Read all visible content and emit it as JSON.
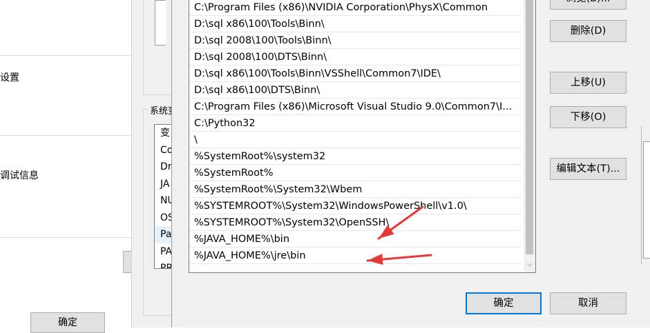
{
  "background_window": {
    "settings_fragment": "设置",
    "debug_fragment": "调试信息",
    "ok_button": "确定"
  },
  "system_properties": {
    "group_label": "系统变量(S)",
    "list_rows": [
      "变",
      "Co",
      "Dr",
      "JA",
      "NU",
      "OS",
      "Pa",
      "PA",
      "PR"
    ]
  },
  "edit_env_dialog": {
    "path_entries": [
      "C:\\Program Files (x86)\\NVIDIA Corporation\\PhysX\\Common",
      "D:\\sql x86\\100\\Tools\\Binn\\",
      "D:\\sql 2008\\100\\Tools\\Binn\\",
      "D:\\sql 2008\\100\\DTS\\Binn\\",
      "D:\\sql x86\\100\\Tools\\Binn\\VSShell\\Common7\\IDE\\",
      "D:\\sql x86\\100\\DTS\\Binn\\",
      "C:\\Program Files (x86)\\Microsoft Visual Studio 9.0\\Common7\\I...",
      "C:\\Python32",
      "\\",
      "%SystemRoot%\\system32",
      "%SystemRoot%",
      "%SystemRoot%\\System32\\Wbem",
      "%SYSTEMROOT%\\System32\\WindowsPowerShell\\v1.0\\",
      "%SYSTEMROOT%\\System32\\OpenSSH\\",
      "%JAVA_HOME%\\bin",
      "%JAVA_HOME%\\jre\\bin"
    ],
    "buttons": {
      "browse": "浏览(B)...",
      "delete": "删除(D)",
      "move_up": "上移(U)",
      "move_down": "下移(O)",
      "edit_text": "编辑文本(T)...",
      "ok": "确定",
      "cancel": "取消"
    }
  },
  "annotation": {
    "arrow_color": "#e53935"
  }
}
